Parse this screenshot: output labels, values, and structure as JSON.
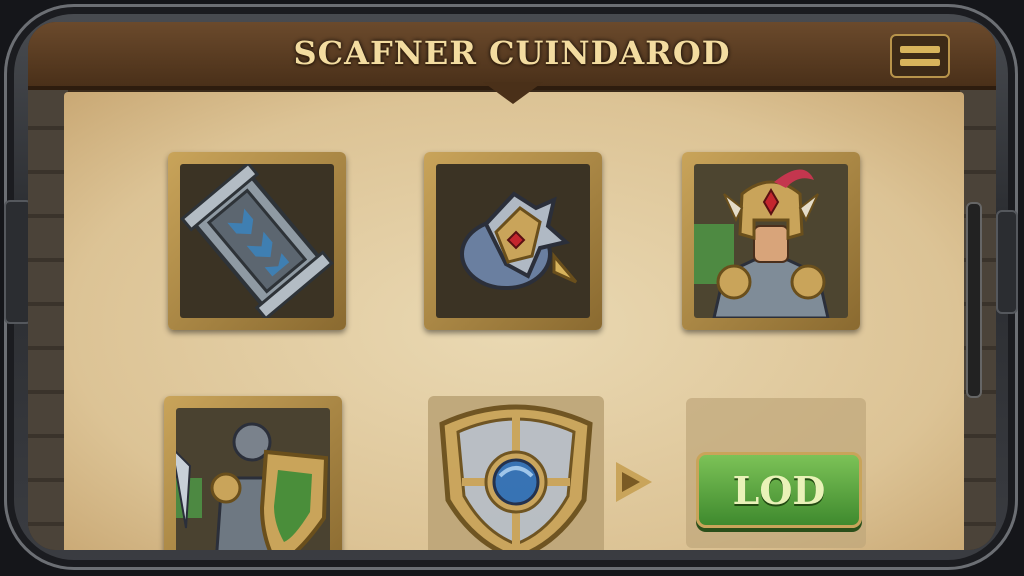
{
  "header": {
    "title": "SCAFNER CUINDAROD"
  },
  "icons": {
    "menu": "hamburger-menu-icon",
    "next": "play-arrow-icon"
  },
  "grid": {
    "items": [
      {
        "name": "iron-bracer"
      },
      {
        "name": "steel-gauntlet"
      },
      {
        "name": "knight-helmet-hero"
      },
      {
        "name": "shield-knight-hero"
      },
      {
        "name": "gold-shield"
      }
    ]
  },
  "actions": {
    "load_label": "LOD"
  },
  "colors": {
    "accent_gold": "#c9a45a",
    "button_green": "#5aa83f",
    "parchment": "#e6d3a8"
  }
}
